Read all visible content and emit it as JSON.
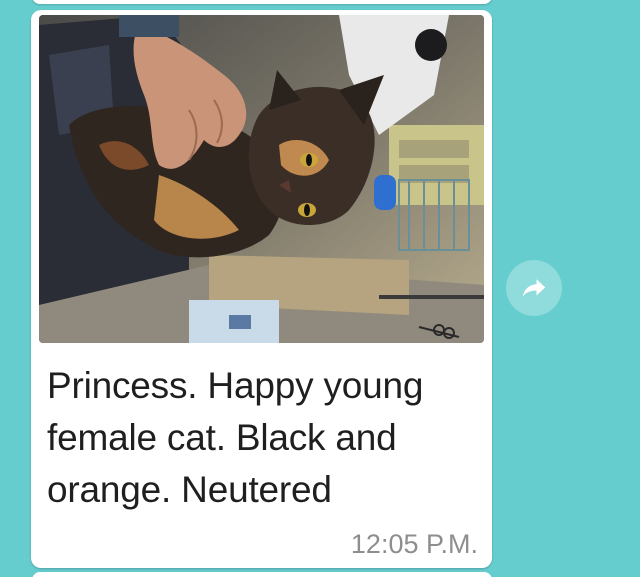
{
  "message": {
    "caption": "Princess. Happy young female cat. Black and orange. Neutered",
    "timestamp": "12:05 P.M.",
    "image_subject": "tortoiseshell-cat-photo"
  },
  "forward": {
    "icon": "forward-arrow-icon"
  },
  "colors": {
    "background": "#66CDCF",
    "bubble": "#FFFFFF",
    "timestamp": "#8E8E8E"
  }
}
